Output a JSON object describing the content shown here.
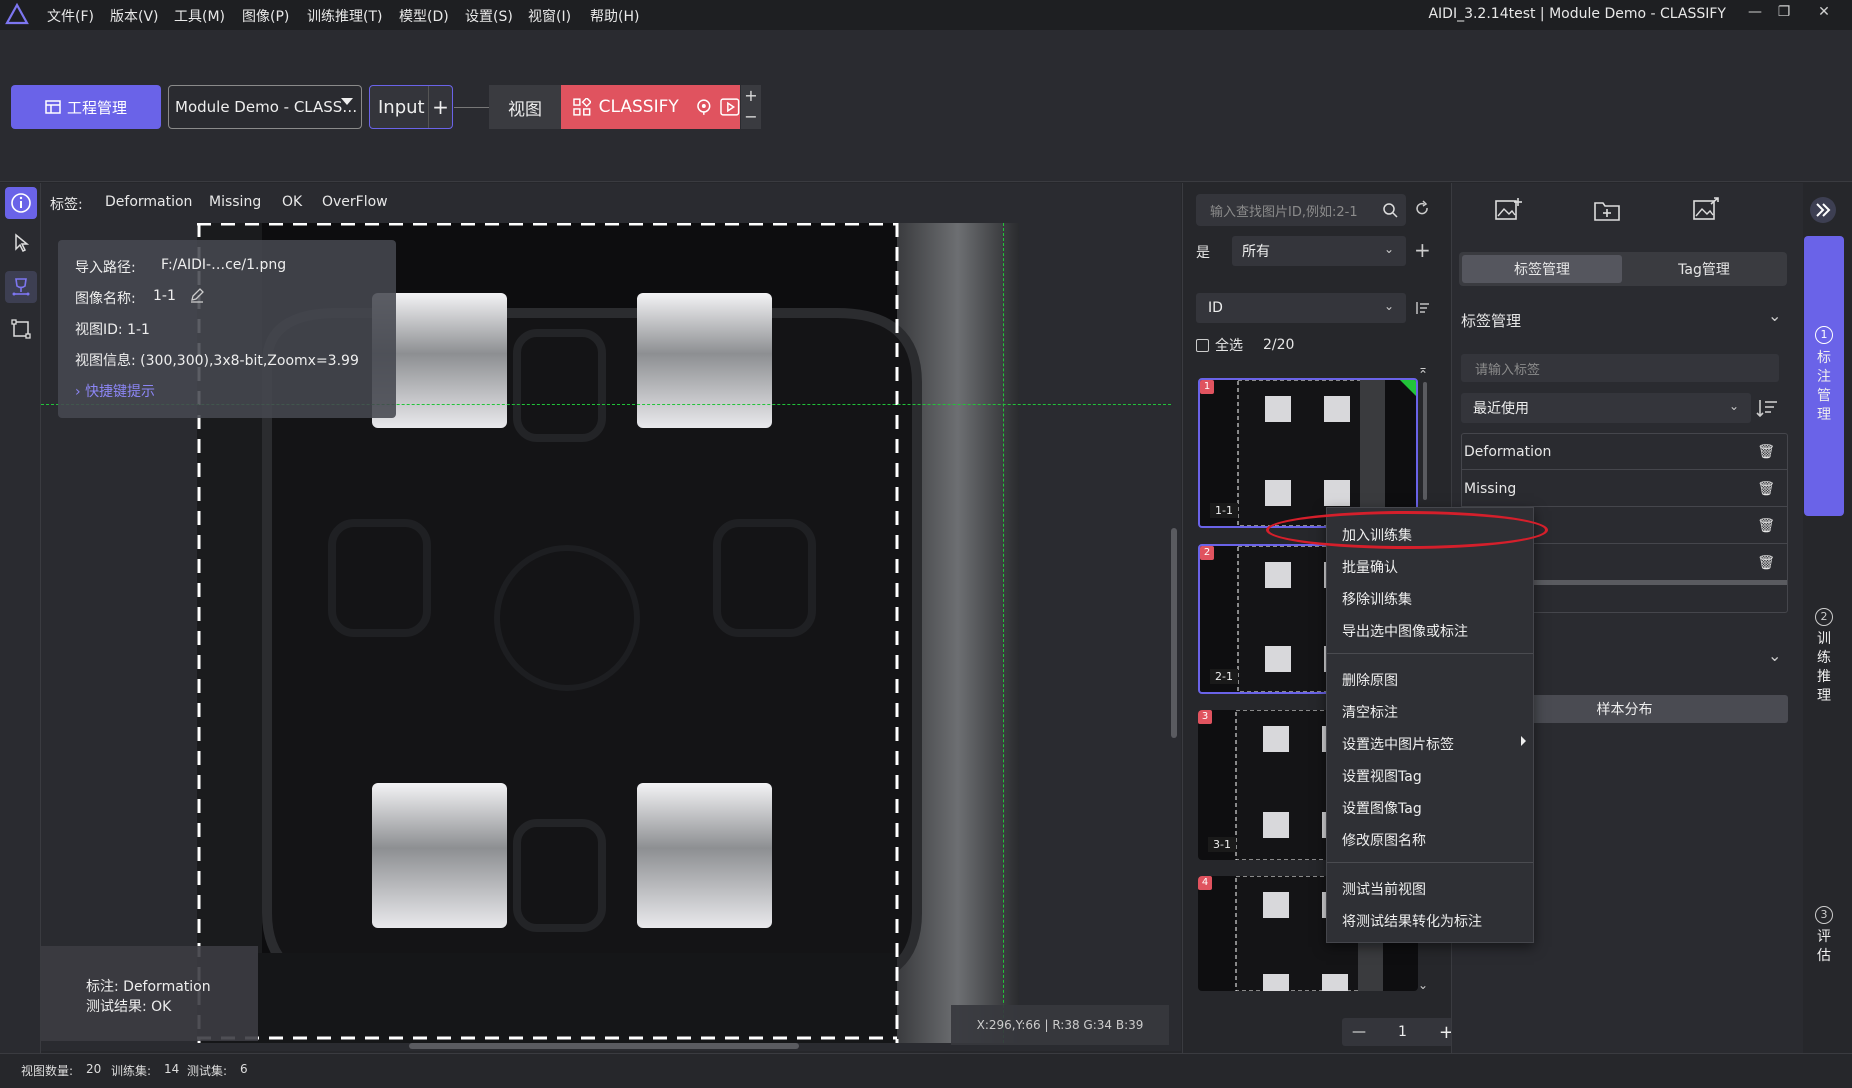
{
  "menu": {
    "items": [
      "文件(F)",
      "版本(V)",
      "工具(M)",
      "图像(P)",
      "训练推理(T)",
      "模型(D)",
      "设置(S)",
      "视窗(I)",
      "帮助(H)"
    ],
    "window_title": "AIDI_3.2.14test | Module Demo - CLASSIFY"
  },
  "toolbar": {
    "project_button": "工程管理",
    "project_select": "Module Demo - CLASS…",
    "input_node": "Input",
    "view_node": "视图",
    "classify_node": "CLASSIFY"
  },
  "labels_bar": {
    "prefix": "标签:",
    "labels": [
      "Deformation",
      "Missing",
      "OK",
      "OverFlow"
    ]
  },
  "info": {
    "path_label": "导入路径:",
    "path_value": "F:/AIDI-…ce/1.png",
    "name_label": "图像名称:",
    "name_value": "1-1",
    "view_id": "视图ID: 1-1",
    "view_info": "视图信息: (300,300),3x8-bit,Zoomx=3.99",
    "shortcut": "快捷键提示"
  },
  "annotation": {
    "label": "标注: Deformation",
    "test": "测试结果: OK"
  },
  "coord": "X:296,Y:66 | R:38 G:34 B:39",
  "thumbs": {
    "search_placeholder": "输入查找图片ID,例如:2-1",
    "filter_prefix": "是",
    "filter_value": "所有",
    "sort_value": "ID",
    "select_all": "全选",
    "count": "2/20",
    "items": [
      {
        "badge": "1",
        "id": "1-1"
      },
      {
        "badge": "2",
        "id": "2-1"
      },
      {
        "badge": "3",
        "id": "3-1"
      },
      {
        "badge": "4",
        "id": ""
      }
    ],
    "page": "1"
  },
  "right_panel": {
    "tab_labels": "标签管理",
    "tab_tags": "Tag管理",
    "section_title": "标签管理",
    "label_input_placeholder": "请输入标签",
    "recent": "最近使用",
    "label_rows": [
      "Deformation",
      "Missing",
      "",
      ""
    ],
    "dist_button": "样本分布"
  },
  "steps": {
    "one_num": "1",
    "one_text": [
      "标",
      "注",
      "管",
      "理"
    ],
    "two_num": "2",
    "two_text": [
      "训",
      "练",
      "推",
      "理"
    ],
    "three_num": "3",
    "three_text": [
      "评",
      "估"
    ]
  },
  "status": {
    "views_label": "视图数量:",
    "views_value": "20",
    "train_label": "训练集:",
    "train_value": "14",
    "test_label": "测试集:",
    "test_value": "6"
  },
  "context_menu": {
    "items": [
      "加入训练集",
      "批量确认",
      "移除训练集",
      "导出选中图像或标注",
      "删除原图",
      "清空标注",
      "设置选中图片标签",
      "设置视图Tag",
      "设置图像Tag",
      "修改原图名称",
      "测试当前视图",
      "将测试结果转化为标注"
    ]
  },
  "colors": {
    "accent": "#6a63e8",
    "classify": "#e0535f",
    "highlight_ellipse": "#d51f2b",
    "crosshair": "#22c33a"
  }
}
